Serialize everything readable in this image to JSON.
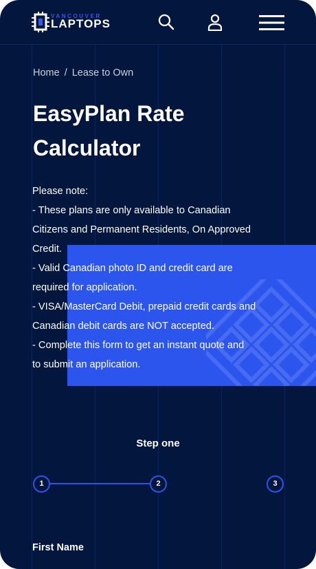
{
  "brand": {
    "small": "VANCOUVER",
    "big": "LAPTOPS"
  },
  "header": {
    "icons": [
      "search-icon",
      "user-icon",
      "menu-icon"
    ]
  },
  "breadcrumb": {
    "home": "Home",
    "separator": "/",
    "current": "Lease to Own"
  },
  "page": {
    "title": "EasyPlan Rate Calculator"
  },
  "notes": {
    "lines": [
      "Please note:",
      "- These plans are only available to Canadian",
      "Citizens and Permanent Residents, On Approved",
      "Credit.",
      "- Valid Canadian photo ID and credit card are",
      "required for application.",
      "- VISA/MasterCard Debit, prepaid credit cards and",
      "Canadian debit cards are NOT accepted.",
      "- Complete this form to get an instant quote and",
      "to submit an application."
    ]
  },
  "stepper": {
    "label": "Step one",
    "steps": [
      "1",
      "2",
      "3"
    ],
    "current_step": 1
  },
  "form": {
    "first_name_label": "First Name"
  },
  "colors": {
    "background": "#03163d",
    "accent": "#2b55ec",
    "text": "#ffffff"
  }
}
